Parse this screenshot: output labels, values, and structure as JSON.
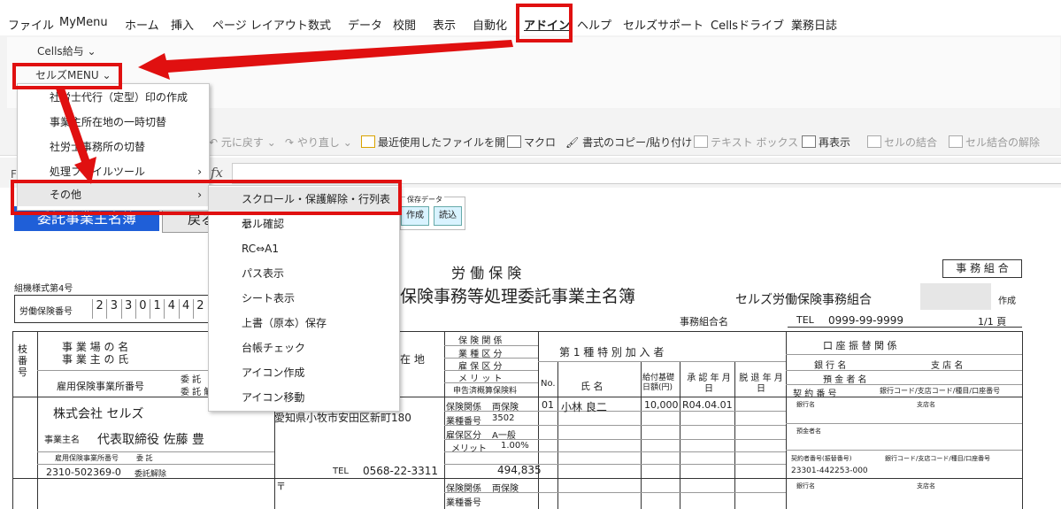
{
  "tabs": [
    "ファイル",
    "MyMenu",
    "ホーム",
    "挿入",
    "ページ レイアウト",
    "数式",
    "データ",
    "校閲",
    "表示",
    "自動化",
    "アドイン",
    "ヘルプ",
    "セルズサポート",
    "Cellsドライブ",
    "業務日誌"
  ],
  "ribbon": {
    "cells_kyuyo": "Cells給与 ⌄",
    "cellz_menu": "セルズMENU ⌄"
  },
  "qat": {
    "undo": "元に戻す",
    "redo": "やり直し",
    "recent": "最近使用したファイルを開く",
    "macro": "マクロ",
    "format_copy": "書式のコピー/貼り付け",
    "textbox": "テキスト ボックス",
    "redisplay": "再表示",
    "merge": "セルの結合",
    "unmerge": "セル結合の解除"
  },
  "formula": {
    "fx": "fx",
    "name_box": "F"
  },
  "menu1": [
    "社労士代行（定型）印の作成",
    "事業主所在地の一時切替",
    "社労士事務所の切替",
    "処理ファイルツール",
    "その他"
  ],
  "menu2": [
    "スクロール・保護解除・行列表示",
    "セル確認",
    "RC⇔A1",
    "パス表示",
    "シート表示",
    "上書（原本）保存",
    "台帳チェック",
    "アイコン作成",
    "アイコン移動"
  ],
  "sheet": {
    "btn_blue": "委託事業主名簿",
    "btn_back": "戻る",
    "save_data_label": "保存データ",
    "save_create": "作成",
    "save_load": "読込",
    "header_title1": "労 働 保 険",
    "header_title2": "保険事務等処理委託事業主名簿",
    "jimu_kumiai": "事 務 組 合",
    "org_name": "セルズ労働保険事務組合",
    "sakusei": "作成",
    "form_no": "組機様式第4号",
    "rodo_no_label": "労働保険番号",
    "rodo_digits": [
      "2",
      "3",
      "3",
      "0",
      "1",
      "4",
      "4",
      "2"
    ],
    "jimu_kumiai_name": "事務組合名",
    "tel_label": "TEL",
    "tel_value": "0999-99-9999",
    "page": "1/1 頁",
    "col_edaban": "枝番号",
    "col_jigyo": "事 業 場 の 名",
    "col_jigyonushi": "事 業 主 の 氏",
    "col_shozaichi": "在 地",
    "col_hoken_kankei": "保 険 関 係",
    "col_gyoshu": "業 種 区 分",
    "col_koyo": "雇 保 区 分",
    "col_merit": "メ リ ッ ト",
    "col_shinkoku": "申告済概算保険料",
    "col_koyo_no": "雇用保険事業所番号",
    "col_itaku": "委 託",
    "col_itaku_kaijo": "委 託 解",
    "col_no": "No.",
    "col_dai1": "第 1 種 特 別 加 入 者",
    "col_shimei": "氏 名",
    "col_kyufu": "給付基礎日額(円)",
    "col_shonin": "承 認 年 月 日",
    "col_dattai": "脱 退 年 月 日",
    "col_koza": "口 座 振 替 関 係",
    "col_ginko": "銀 行 名",
    "col_shiten": "支 店 名",
    "col_yokin": "預 金 者 名",
    "col_keiyaku": "契 約 番 号",
    "col_code": "銀行コード/支店コード/種目/口座番号",
    "row1": {
      "company": "株式会社 セルズ",
      "owner_label": "事業主名",
      "owner": "代表取締役 佐藤 豊",
      "koyo_label": "雇用保険事業所番号",
      "itaku_label": "委 託",
      "koyo_no": "2310-502369-0",
      "itaku_kaijo": "委託解除",
      "address": "愛知県小牧市安田区新町180",
      "tel_label": "TEL",
      "tel": "0568-22-3311",
      "premium": "494,835",
      "hk": "保険関係",
      "hk_v": "両保険",
      "gs": "業種番号",
      "gs_v": "3502",
      "ky": "雇保区分",
      "ky_v": "A一般",
      "mr": "メリット",
      "mr_v": "1.00%",
      "no": "01",
      "name": "小林 良二",
      "kyufu": "10,000",
      "shonin": "R04.04.01",
      "ginko": "銀行名",
      "shiten": "支店名",
      "yokin": "預金者名",
      "keiyaku_label": "契約者番号(振替番号)",
      "code_label": "銀行コード/支店コード/種目/口座番号",
      "keiyaku": "23301-442253-000"
    },
    "row2": {
      "postal": "〒",
      "hk": "保険関係",
      "hk_v": "両保険",
      "gs": "業種番号",
      "ginko": "銀行名",
      "shiten": "支店名"
    }
  }
}
